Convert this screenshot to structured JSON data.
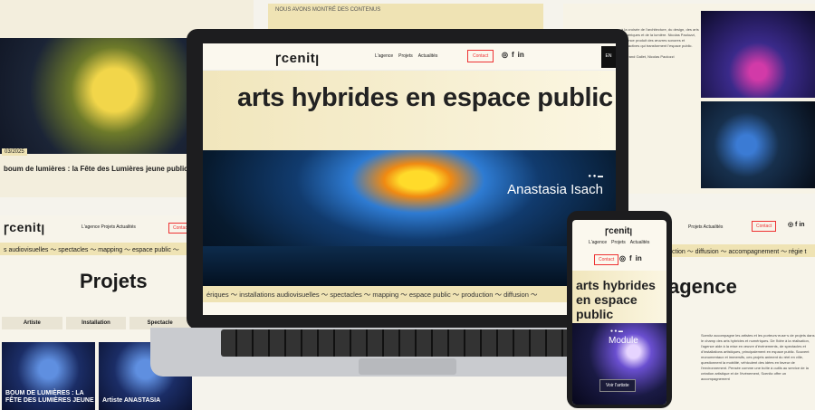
{
  "top_left": {
    "date": "03/2025",
    "caption": "boum de lumières : la Fête des Lumières jeune public"
  },
  "top_middle": {
    "text": "NOUS AVONS MONTRÉ DES CONTENUS"
  },
  "top_right": {
    "intro": "à la croisée de l'architecture, du design, des arts numériques et de la lumière. Nicolas Paolozzi, l'agence produit des œuvres sonores et interactives qui transforment l'espace public.",
    "credit": "Bertrand Gallet, Nicolas Paolozzi"
  },
  "left_panel": {
    "logo": "ꞅcenitꞁ",
    "nav": "L'agence  Projets  Actualités",
    "contact": "Contact",
    "ticker": "s audiovisuelles 〜 spectacles 〜 mapping 〜 espace public 〜",
    "title": "Projets",
    "tabs": [
      "Artiste",
      "Installation",
      "Spectacle"
    ],
    "cards": [
      "BOUM DE LUMIÈRES : LA FÊTE DES LUMIÈRES JEUNE",
      "Artiste ANASTASIA"
    ]
  },
  "right_panel": {
    "nav": "Projets  Actualités",
    "contact": "Contact",
    "icons": "◎ f in",
    "ticker": "ction 〜 diffusion 〜 accompagnement 〜 régie t",
    "title": "agence",
    "para": "Scenitz accompagne les artistes et les porteurs·euse·s de projets dans le champ des arts hybrides et numériques. De l'idée à la réalisation, l'agence aide à la mise en œuvre d'événements, de spectacles et d'installations artistiques, principalement en espace public. Souvent monumentaux et immersifs, ces projets animent du réel en ville, questionnent la mobilité, véhiculent des idées en faveur de l'environnement. Pensée comme une boîte à outils au service de la création artistique et de l'événement, Scenitz offre un accompagnement"
  },
  "laptop": {
    "logo": "ꞅcenitꞁ",
    "nav": [
      "L'agence",
      "Projets",
      "Actualités"
    ],
    "contact": "Contact",
    "icons": [
      "◎",
      "f",
      "in"
    ],
    "lang": "EN",
    "hero_title": "arts hybrides en espace public",
    "artist": "Anastasia Isach",
    "dots": "● ●  ▬",
    "ticker": "ériques 〜 installations audiovisuelles 〜 spectacles 〜 mapping 〜 espace public 〜 production 〜 diffusion 〜"
  },
  "phone": {
    "logo": "ꞅcenitꞁ",
    "nav": [
      "L'agence",
      "Projets",
      "Actualités"
    ],
    "contact": "Contact",
    "icons": [
      "◎",
      "f",
      "in"
    ],
    "hero_title": "arts hybrides en espace public",
    "module": "Module",
    "dots": "● ●  ▬",
    "button": "Voir l'artiste"
  }
}
